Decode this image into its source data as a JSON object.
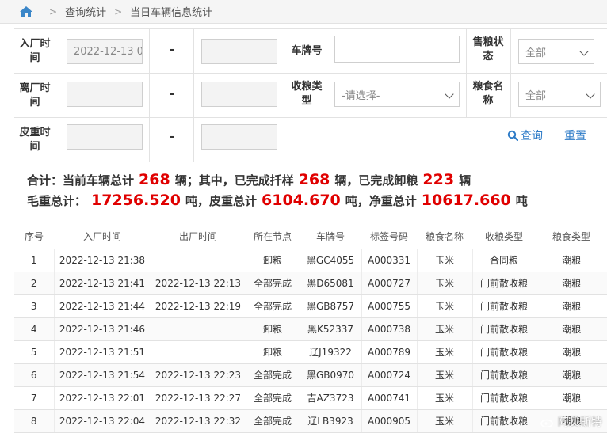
{
  "breadcrumb": {
    "items": [
      "查询统计",
      "当日车辆信息统计"
    ]
  },
  "filters": {
    "entry_time_label": "入厂时间",
    "entry_time_start": "2022-12-13 0",
    "exit_time_label": "离厂时间",
    "tare_time_label": "皮重时间",
    "range_sep": "-",
    "plate_label": "车牌号",
    "sale_status_label": "售粮状态",
    "sale_status_value": "全部",
    "receive_type_label": "收粮类型",
    "receive_type_value": "-请选择-",
    "grain_name_label": "粮食名称",
    "grain_name_value": "全部",
    "query_label": "查询",
    "reset_label": "重置"
  },
  "summary": {
    "t1": "合计：当前车辆总计",
    "total_vehicles": "268",
    "t2": "辆；其中，已完成扦样",
    "sampled": "268",
    "t3": "辆，已完成卸粮",
    "unloaded": "223",
    "t4": "辆",
    "t5": "毛重总计：",
    "gross_total": "17256.520",
    "t6": "吨，皮重总计",
    "tare_total": "6104.670",
    "t7": "吨，净重总计",
    "net_total": "10617.660",
    "t8": "吨"
  },
  "table": {
    "headers": [
      "序号",
      "入厂时间",
      "出厂时间",
      "所在节点",
      "车牌号",
      "标签号码",
      "粮食名称",
      "收粮类型",
      "粮食类型"
    ],
    "rows": [
      [
        "1",
        "2022-12-13 21:38",
        "",
        "卸粮",
        "黑GC4055",
        "A000331",
        "玉米",
        "合同粮",
        "潮粮"
      ],
      [
        "2",
        "2022-12-13 21:41",
        "2022-12-13 22:13",
        "全部完成",
        "黑D65081",
        "A000727",
        "玉米",
        "门前散收粮",
        "潮粮"
      ],
      [
        "3",
        "2022-12-13 21:44",
        "2022-12-13 22:19",
        "全部完成",
        "黑GB8757",
        "A000755",
        "玉米",
        "门前散收粮",
        "潮粮"
      ],
      [
        "4",
        "2022-12-13 21:46",
        "",
        "卸粮",
        "黑K52337",
        "A000738",
        "玉米",
        "门前散收粮",
        "潮粮"
      ],
      [
        "5",
        "2022-12-13 21:51",
        "",
        "卸粮",
        "辽J19322",
        "A000789",
        "玉米",
        "门前散收粮",
        "潮粮"
      ],
      [
        "6",
        "2022-12-13 21:54",
        "2022-12-13 22:23",
        "全部完成",
        "黑GB0970",
        "A000724",
        "玉米",
        "门前散收粮",
        "潮粮"
      ],
      [
        "7",
        "2022-12-13 22:01",
        "2022-12-13 22:27",
        "全部完成",
        "吉AZ3723",
        "A000741",
        "玉米",
        "门前散收粮",
        "潮粮"
      ],
      [
        "8",
        "2022-12-13 22:04",
        "2022-12-13 22:32",
        "全部完成",
        "辽LB3923",
        "A000905",
        "玉米",
        "门前散收粮",
        "潮粮"
      ]
    ]
  },
  "watermark": "阿贝斯特",
  "colors": {
    "accent": "#2d7bc7",
    "highlight": "#e00000"
  }
}
